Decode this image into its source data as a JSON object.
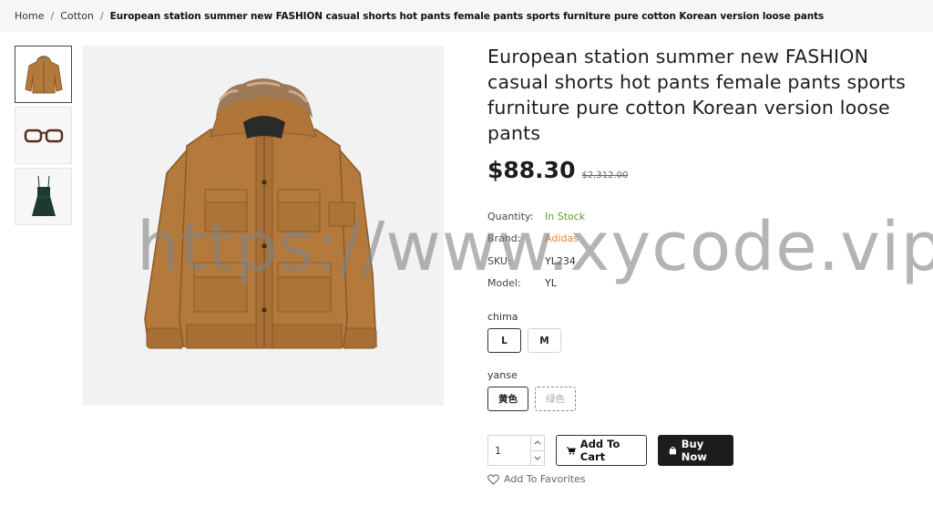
{
  "breadcrumb": {
    "home": "Home",
    "category": "Cotton",
    "current": "European station summer new FASHION casual shorts hot pants female pants sports furniture pure cotton Korean version loose pants"
  },
  "gallery": {
    "thumbnails": [
      {
        "icon": "jacket-thumbnail-icon",
        "active": true
      },
      {
        "icon": "glasses-thumbnail-icon",
        "active": false
      },
      {
        "icon": "dress-thumbnail-icon",
        "active": false
      }
    ],
    "main_image": "brown-hooded-jacket-image"
  },
  "product": {
    "title": "European station summer new FASHION casual shorts hot pants female pants sports furniture pure cotton Korean version loose pants",
    "price": "$88.30",
    "old_price": "$2,312.00",
    "quantity_label": "Quantity:",
    "quantity_status": "In Stock",
    "brand_label": "Brand:",
    "brand_value": "Adidas",
    "sku_label": "SKU:",
    "sku_value": "YL234",
    "model_label": "Model:",
    "model_value": "YL"
  },
  "options": {
    "size_label": "chima",
    "sizes": [
      "L",
      "M"
    ],
    "color_label": "yanse",
    "colors": [
      "黄色",
      "绿色"
    ]
  },
  "cart": {
    "qty_value": "1",
    "add_to_cart": "Add To Cart",
    "buy_now": "Buy Now",
    "favorites": "Add To Favorites"
  },
  "watermark": "https://www.xycode.vip",
  "colors": {
    "in_stock": "#5aa02c",
    "brand": "#e8843a",
    "jacket": "#b47a3c",
    "buy_button": "#1d1d1d"
  }
}
